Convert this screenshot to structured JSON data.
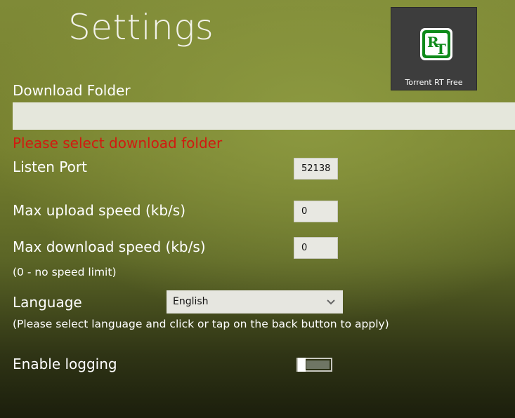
{
  "page": {
    "title": "Settings"
  },
  "app_tile": {
    "logo_text": "RT",
    "label": "Torrent RT Free",
    "logo_color": "#0f8a1a"
  },
  "download_folder": {
    "label": "Download Folder",
    "value": "",
    "error": "Please select download folder",
    "error_color": "#d11a10"
  },
  "listen_port": {
    "label": "Listen Port",
    "value": "52138"
  },
  "max_upload": {
    "label": "Max upload speed (kb/s)",
    "value": "0"
  },
  "max_download": {
    "label": "Max download speed (kb/s)",
    "value": "0"
  },
  "speed_hint": "(0 - no speed limit)",
  "language": {
    "label": "Language",
    "selected": "English",
    "hint": "(Please select language and click or tap on the back button to apply)"
  },
  "logging": {
    "label": "Enable logging",
    "enabled": false
  }
}
